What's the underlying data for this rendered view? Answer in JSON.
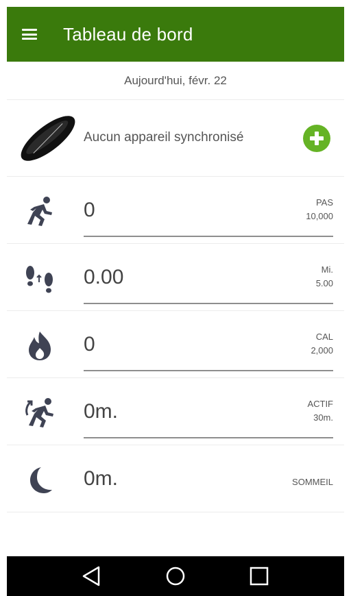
{
  "appbar": {
    "title": "Tableau de bord",
    "menu_icon": "menu-icon"
  },
  "date": "Aujourd'hui, févr. 22",
  "device": {
    "text": "Aucun appareil synchronisé",
    "icon": "fitness-band-icon",
    "add_icon": "plus-circle-icon",
    "add_color": "#65b325"
  },
  "metrics": [
    {
      "value": "0",
      "unit": "PAS",
      "goal": "10,000",
      "icon": "running-icon"
    },
    {
      "value": "0.00",
      "unit": "Mi.",
      "goal": "5.00",
      "icon": "footprints-icon"
    },
    {
      "value": "0",
      "unit": "CAL",
      "goal": "2,000",
      "icon": "flame-icon"
    },
    {
      "value": "0m.",
      "unit": "ACTIF",
      "goal": "30m.",
      "icon": "active-running-icon"
    },
    {
      "value": "0m.",
      "unit": "SOMMEIL",
      "goal": "",
      "icon": "moon-icon"
    }
  ],
  "navbar": {
    "back_icon": "back-triangle-icon",
    "home_icon": "home-circle-icon",
    "recent_icon": "recent-square-icon"
  },
  "colors": {
    "appbar": "#3a7a0c",
    "accent": "#65b325",
    "icon": "#3f4354"
  }
}
